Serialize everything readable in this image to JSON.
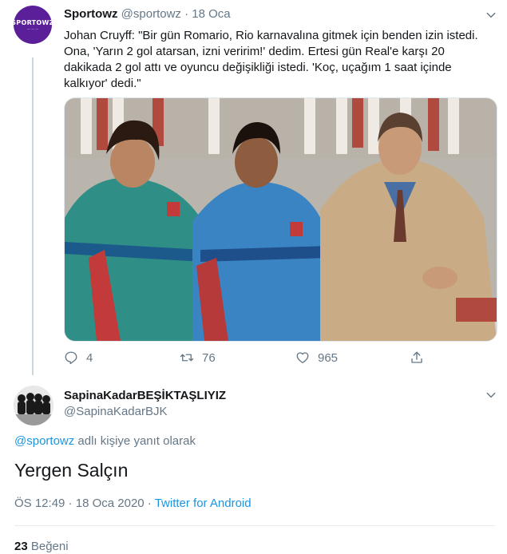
{
  "tweet": {
    "avatar_text": "SPORTOWZ",
    "display_name": "Sportowz",
    "handle": "@sportowz",
    "separator": "·",
    "date": "18 Oca",
    "text": "Johan Cruyff: \"Bir gün Romario, Rio karnavalına gitmek için benden izin istedi. Ona, 'Yarın 2 gol atarsan, izni veririm!' dedim. Ertesi gün Real'e karşı 20 dakikada 2 gol attı ve oyuncu değişikliği istedi. 'Koç, uçağım 1 saat içinde kalkıyor' dedi.\"",
    "actions": {
      "reply_count": "4",
      "retweet_count": "76",
      "like_count": "965"
    }
  },
  "reply": {
    "display_name": "SapinaKadarBEŞİKTAŞLIYIZ",
    "handle": "@SapinaKadarBJK",
    "reply_to_mention": "@sportowz",
    "reply_to_suffix": " adlı kişiye yanıt olarak",
    "text": "Yergen Salçın",
    "time": "ÖS 12:49",
    "separator": " · ",
    "date": "18 Oca 2020",
    "source": "Twitter for Android",
    "like_count": "23",
    "like_label": "Beğeni"
  },
  "colors": {
    "link": "#1b95e0",
    "muted": "#657786",
    "avatar_purple": "#5b1f9a"
  }
}
